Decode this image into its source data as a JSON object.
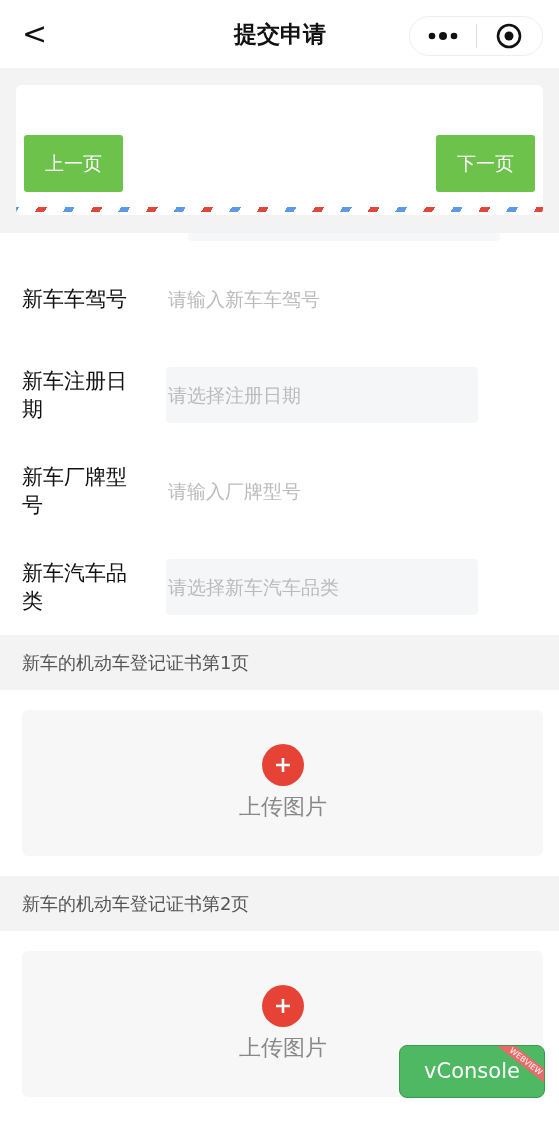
{
  "nav": {
    "back": "<",
    "title": "提交申请"
  },
  "pager": {
    "prev": "上一页",
    "next": "下一页"
  },
  "rows": [
    {
      "label": "新车车驾号",
      "kind": "input",
      "placeholder": "请输入新车车驾号"
    },
    {
      "label": "新车注册日期",
      "kind": "select",
      "placeholder": "请选择注册日期"
    },
    {
      "label": "新车厂牌型号",
      "kind": "input",
      "placeholder": "请输入厂牌型号"
    },
    {
      "label": "新车汽车品类",
      "kind": "select",
      "placeholder": "请选择新车汽车品类"
    }
  ],
  "uploads": [
    {
      "section": "新车的机动车登记证书第1页",
      "button": "上传图片"
    },
    {
      "section": "新车的机动车登记证书第2页",
      "button": "上传图片"
    }
  ],
  "console": {
    "label": "vConsole",
    "tag": "WEBVIEW"
  }
}
